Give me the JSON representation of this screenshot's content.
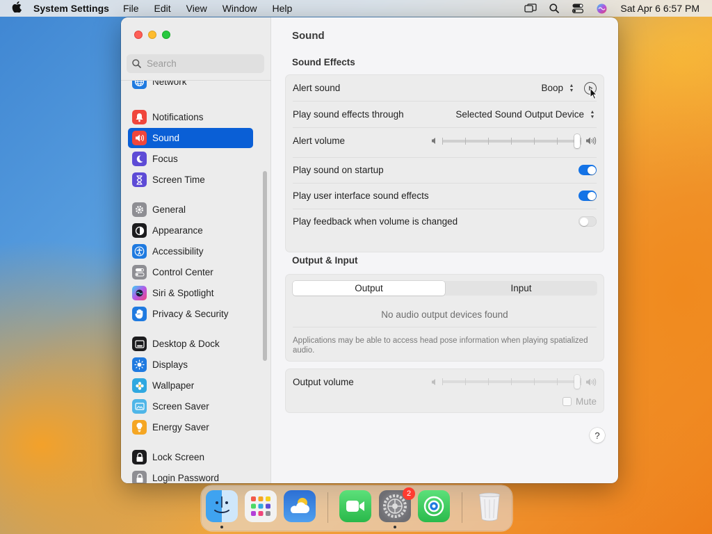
{
  "menubar": {
    "app_name": "System Settings",
    "items": [
      "File",
      "Edit",
      "View",
      "Window",
      "Help"
    ],
    "clock": "Sat Apr 6  6:57 PM"
  },
  "sidebar": {
    "search_placeholder": "Search",
    "items": [
      {
        "label": "Network",
        "icon": "globe-icon",
        "color": "#1f7ae0"
      },
      {
        "label": "Notifications",
        "icon": "bell-icon",
        "color": "#f0463c"
      },
      {
        "label": "Sound",
        "icon": "speaker-icon",
        "color": "#f0463c",
        "selected": true
      },
      {
        "label": "Focus",
        "icon": "moon-icon",
        "color": "#5d4bd6"
      },
      {
        "label": "Screen Time",
        "icon": "hourglass-icon",
        "color": "#5d4bd6"
      },
      {
        "label": "General",
        "icon": "gear-icon",
        "color": "#8e8e93"
      },
      {
        "label": "Appearance",
        "icon": "appearance-icon",
        "color": "#1c1c1e"
      },
      {
        "label": "Accessibility",
        "icon": "accessibility-icon",
        "color": "#1f7ae0"
      },
      {
        "label": "Control Center",
        "icon": "control-center-icon",
        "color": "#8e8e93"
      },
      {
        "label": "Siri & Spotlight",
        "icon": "siri-icon",
        "color": "#b33fd8"
      },
      {
        "label": "Privacy & Security",
        "icon": "hand-icon",
        "color": "#1f7ae0"
      },
      {
        "label": "Desktop & Dock",
        "icon": "dock-icon",
        "color": "#1c1c1e"
      },
      {
        "label": "Displays",
        "icon": "sun-icon",
        "color": "#1f7ae0"
      },
      {
        "label": "Wallpaper",
        "icon": "flower-icon",
        "color": "#2fa8e0"
      },
      {
        "label": "Screen Saver",
        "icon": "screensaver-icon",
        "color": "#4fb6e8"
      },
      {
        "label": "Energy Saver",
        "icon": "bulb-icon",
        "color": "#f5a623"
      },
      {
        "label": "Lock Screen",
        "icon": "lock-icon",
        "color": "#1c1c1e"
      },
      {
        "label": "Login Password",
        "icon": "lock-icon",
        "color": "#8e8e93"
      }
    ]
  },
  "content": {
    "title": "Sound",
    "sound_effects": {
      "heading": "Sound Effects",
      "alert_sound_label": "Alert sound",
      "alert_sound_value": "Boop",
      "play_through_label": "Play sound effects through",
      "play_through_value": "Selected Sound Output Device",
      "alert_volume_label": "Alert volume",
      "alert_volume_level": 0.97,
      "startup_label": "Play sound on startup",
      "startup_on": true,
      "ui_sounds_label": "Play user interface sound effects",
      "ui_sounds_on": true,
      "feedback_label": "Play feedback when volume is changed",
      "feedback_on": false
    },
    "output_input": {
      "heading": "Output & Input",
      "tab_output": "Output",
      "tab_input": "Input",
      "no_devices": "No audio output devices found",
      "note": "Applications may be able to access head pose information when playing spatialized audio.",
      "output_volume_label": "Output volume",
      "output_volume_level": 0.97,
      "mute_label": "Mute"
    },
    "help_label": "?"
  },
  "dock": {
    "badge_count": "2",
    "apps": [
      "finder",
      "launchpad",
      "weather",
      "facetime",
      "system-settings",
      "find-my",
      "trash"
    ]
  }
}
